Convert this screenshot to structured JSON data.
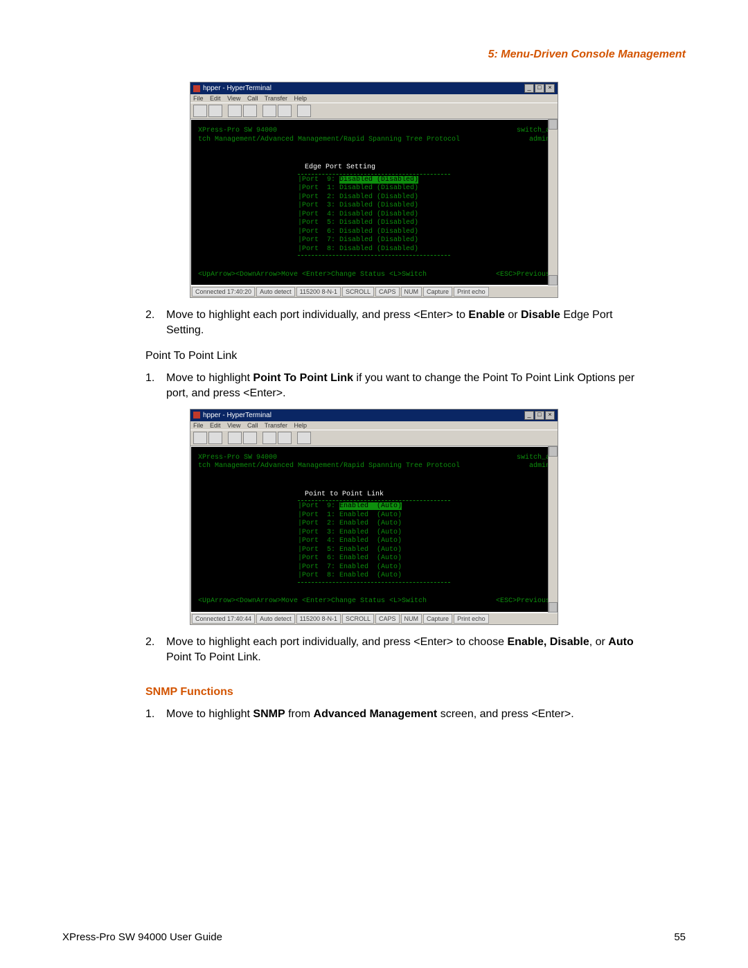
{
  "header": {
    "right": "5: Menu-Driven Console Management"
  },
  "term_common": {
    "title_pre": "hpper - HyperTerminal",
    "minimize_label": "_",
    "restore_label": "□",
    "close_label": "×",
    "menu": {
      "file": "File",
      "edit": "Edit",
      "view": "View",
      "call": "Call",
      "transfer": "Transfer",
      "help": "Help"
    },
    "header_left": "XPress-Pro SW 94000",
    "header_right": "switch_a",
    "breadcrumb": "tch Management/Advanced Management/Rapid Spanning Tree Protocol",
    "breadcrumb_right": "admin",
    "bottom_left": "<UpArrow><DownArrow>Move <Enter>Change Status <L>Switch",
    "bottom_right": "<ESC>Previous",
    "status": {
      "s1": "Auto detect",
      "s2": "115200 8-N-1",
      "s3": "SCROLL",
      "s4": "CAPS",
      "s5": "NUM",
      "s6": "Capture",
      "s7": "Print echo"
    }
  },
  "term1": {
    "connected": "Connected 17:40:20",
    "box_title": "Edge Port Setting",
    "rows": [
      {
        "port": "Port  9:",
        "state": "Disabled",
        "paren": "(Disabled)",
        "hl": true
      },
      {
        "port": "Port  1:",
        "state": "Disabled",
        "paren": "(Disabled)",
        "hl": false
      },
      {
        "port": "Port  2:",
        "state": "Disabled",
        "paren": "(Disabled)",
        "hl": false
      },
      {
        "port": "Port  3:",
        "state": "Disabled",
        "paren": "(Disabled)",
        "hl": false
      },
      {
        "port": "Port  4:",
        "state": "Disabled",
        "paren": "(Disabled)",
        "hl": false
      },
      {
        "port": "Port  5:",
        "state": "Disabled",
        "paren": "(Disabled)",
        "hl": false
      },
      {
        "port": "Port  6:",
        "state": "Disabled",
        "paren": "(Disabled)",
        "hl": false
      },
      {
        "port": "Port  7:",
        "state": "Disabled",
        "paren": "(Disabled)",
        "hl": false
      },
      {
        "port": "Port  8:",
        "state": "Disabled",
        "paren": "(Disabled)",
        "hl": false
      }
    ]
  },
  "term2": {
    "connected": "Connected 17:40:44",
    "box_title": "Point to Point Link",
    "rows": [
      {
        "port": "Port  9:",
        "state": "Enabled ",
        "paren": "(Auto)",
        "hl": true
      },
      {
        "port": "Port  1:",
        "state": "Enabled ",
        "paren": "(Auto)",
        "hl": false
      },
      {
        "port": "Port  2:",
        "state": "Enabled ",
        "paren": "(Auto)",
        "hl": false
      },
      {
        "port": "Port  3:",
        "state": "Enabled ",
        "paren": "(Auto)",
        "hl": false
      },
      {
        "port": "Port  4:",
        "state": "Enabled ",
        "paren": "(Auto)",
        "hl": false
      },
      {
        "port": "Port  5:",
        "state": "Enabled ",
        "paren": "(Auto)",
        "hl": false
      },
      {
        "port": "Port  6:",
        "state": "Enabled ",
        "paren": "(Auto)",
        "hl": false
      },
      {
        "port": "Port  7:",
        "state": "Enabled ",
        "paren": "(Auto)",
        "hl": false
      },
      {
        "port": "Port  8:",
        "state": "Enabled ",
        "paren": "(Auto)",
        "hl": false
      }
    ]
  },
  "body": {
    "step2a_num": "2.",
    "step2a_pre": "Move to highlight each port individually, and press <Enter> to ",
    "step2a_b1": "Enable",
    "step2a_mid": " or ",
    "step2a_b2": "Disable",
    "step2a_post": " Edge Port Setting.",
    "ptpl_heading": "Point To Point Link",
    "step1b_num": "1.",
    "step1b_pre": "Move to highlight ",
    "step1b_b1": "Point To Point Link",
    "step1b_post": " if you want to change the Point To Point Link Options per port, and press <Enter>.",
    "step2c_num": "2.",
    "step2c_pre": "Move to highlight each port individually, and press <Enter> to choose ",
    "step2c_b1": "Enable, Disable",
    "step2c_mid": ", or ",
    "step2c_b2": "Auto",
    "step2c_post": " Point To Point Link.",
    "snmp_title": "SNMP Functions",
    "snmp_num": "1.",
    "snmp_pre": "Move to highlight ",
    "snmp_b1": "SNMP",
    "snmp_mid": " from ",
    "snmp_b2": "Advanced Management",
    "snmp_post": " screen, and press <Enter>."
  },
  "footer": {
    "left": "XPress-Pro SW 94000 User Guide",
    "right": "55"
  }
}
